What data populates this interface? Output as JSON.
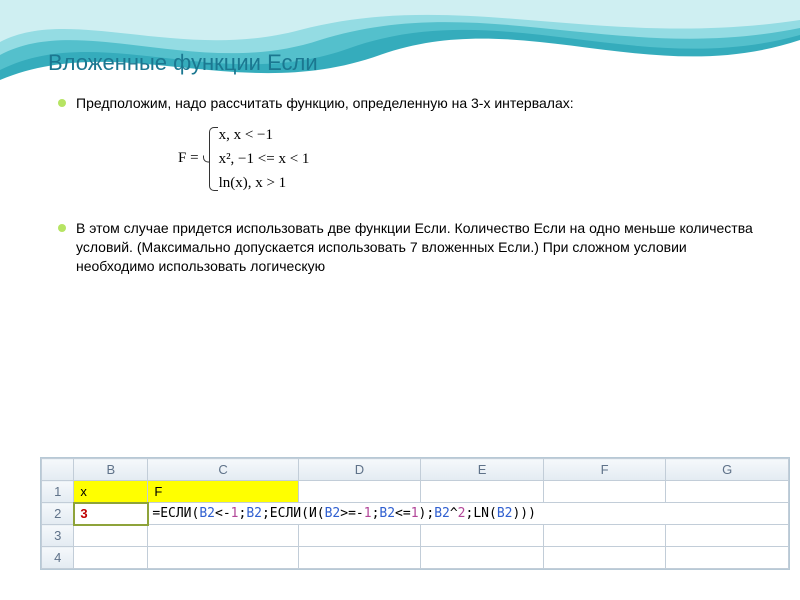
{
  "title": "Вложенные функции Если",
  "bullet1": "Предположим, надо рассчитать функцию, определенную на 3-х интервалах:",
  "bullet2": "В этом случае придется использовать две функции Если. Количество Если на одно меньше количества условий. (Максимально допускается использовать 7 вложенных Если.) При сложном условии необходимо использовать логическую",
  "formula": {
    "lhs": "F =",
    "cases": [
      "x,  x < −1",
      "x², −1 <= x < 1",
      "ln(x), x > 1"
    ]
  },
  "sheet": {
    "columns": [
      "B",
      "C",
      "D",
      "E",
      "F",
      "G"
    ],
    "row1": {
      "B": "x",
      "C": "F"
    },
    "row2": {
      "B": "3",
      "formula_parts": {
        "eq": "=",
        "if1": "ЕСЛИ",
        "lp1": "(",
        "refB2a": "B2",
        "lt": "<-",
        "n1a": "1",
        "sc1": ";",
        "refB2b": "B2",
        "sc2": ";",
        "if2": "ЕСЛИ",
        "lp2": "(",
        "and": "И",
        "lp3": "(",
        "refB2c": "B2",
        "gteq": ">=-",
        "n1b": "1",
        "sc3": ";",
        "refB2d": "B2",
        "lteq": "<=",
        "n1c": "1",
        "rp3": ")",
        "sc4": ";",
        "refB2e": "B2",
        "pow": "^",
        "n2": "2",
        "sc5": ";",
        "ln": "LN",
        "lp4": "(",
        "refB2f": "B2",
        "rp4": ")",
        "rp2": ")",
        "rp1": ")"
      }
    },
    "rownums": [
      "1",
      "2",
      "3",
      "4"
    ]
  }
}
